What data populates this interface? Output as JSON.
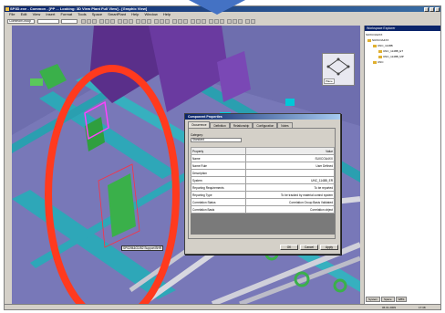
{
  "window": {
    "title": "SP3D.exe - Common - [PP ... Looking: 3D View Plant Full View] - [Graphic View]"
  },
  "menu": [
    "File",
    "Edit",
    "View",
    "Insert",
    "Format",
    "Tools",
    "Space",
    "SmartPlant",
    "Help",
    "Window",
    "Help"
  ],
  "toolbar": {
    "combo_text": "CommonGroup"
  },
  "viewport": {
    "tag_text": "SP02/M&G1/B2 Support BHR"
  },
  "compass": {
    "label": "Plane"
  },
  "dialog": {
    "title": "Component Properties",
    "tabs": [
      "Occurrence",
      "Definition",
      "Relationship",
      "Configuration",
      "Notes"
    ],
    "category_label": "Category:",
    "category_value": "Standard",
    "header": {
      "property": "Property",
      "value": "Value"
    },
    "rows": [
      {
        "property": "Name",
        "value": "SUXCOA4XX"
      },
      {
        "property": "Name Rule",
        "value": "User Defined"
      },
      {
        "property": "Description",
        "value": ""
      },
      {
        "property": "System",
        "value": "UNC_1148B_ER"
      },
      {
        "property": "Reporting Requirements",
        "value": "To be reported"
      },
      {
        "property": "Reporting Type",
        "value": "To be tracked by material control system"
      },
      {
        "property": "Correlation Status",
        "value": "Correlation Group Basis Validated"
      },
      {
        "property": "Correlation Basis",
        "value": "Correlation object"
      }
    ],
    "buttons": {
      "ok": "OK",
      "cancel": "Cancel",
      "apply": "Apply"
    }
  },
  "right_panel": {
    "title": "Workspace Explorer",
    "filter_text": "SUXCOA4XX",
    "tree": [
      {
        "label": "SUXCOA4XX",
        "level": 0
      },
      {
        "label": "UNC_1148B",
        "level": 1
      },
      {
        "label": "UNC_1148B_ET",
        "level": 2
      },
      {
        "label": "UNC_1148B_MP",
        "level": 2
      },
      {
        "label": "UNC",
        "level": 1
      }
    ],
    "tabs": [
      "System",
      "Space",
      "WBS"
    ]
  },
  "status": {
    "left": "",
    "coords": "",
    "date": "06.01.2009",
    "time": "17:38"
  }
}
